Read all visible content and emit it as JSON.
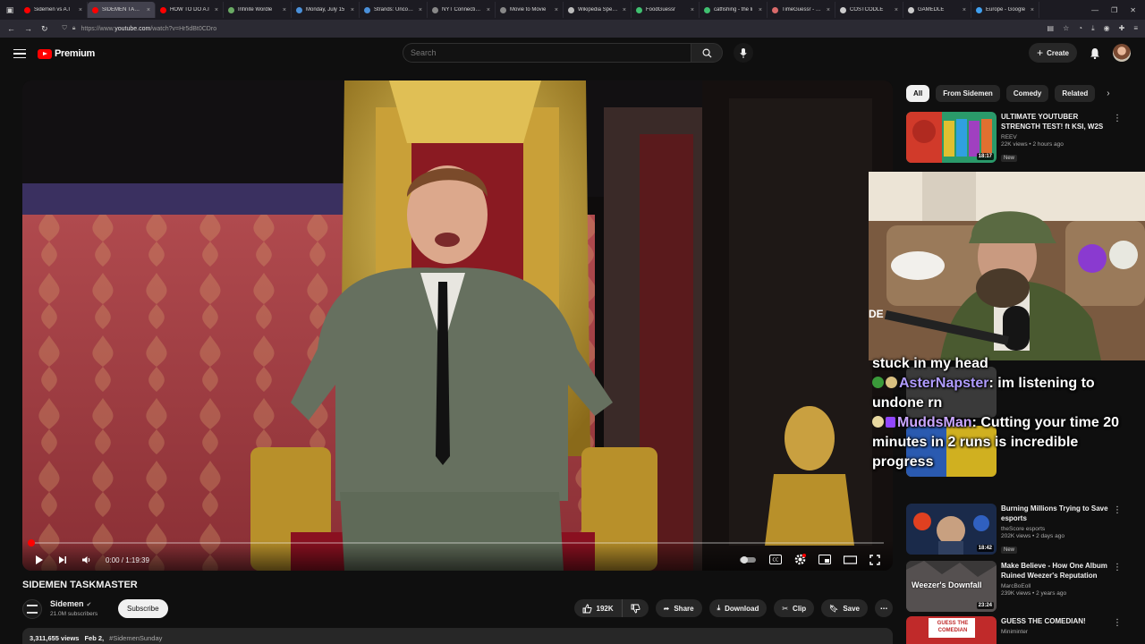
{
  "browser": {
    "tabs": [
      {
        "label": "Sidemen vs A.I",
        "color": "#ff0000",
        "active": false
      },
      {
        "label": "SIDEMEN TASKMASTER",
        "color": "#ff0000",
        "active": true
      },
      {
        "label": "HOW TO DO A.I",
        "color": "#ff0000",
        "active": false
      },
      {
        "label": "Infinite Wordle",
        "color": "#6aaa64",
        "active": false
      },
      {
        "label": "Monday, July 15",
        "color": "#4a90d9",
        "active": false
      },
      {
        "label": "Strands: Uncover",
        "color": "#4a90d9",
        "active": false
      },
      {
        "label": "NYT Connections",
        "color": "#888888",
        "active": false
      },
      {
        "label": "Movie to Movie",
        "color": "#888888",
        "active": false
      },
      {
        "label": "Wikipedia Speedrun!",
        "color": "#bbbbbb",
        "active": false
      },
      {
        "label": "FoodGuessr",
        "color": "#40c070",
        "active": false
      },
      {
        "label": "catfishing - the li",
        "color": "#40c070",
        "active": false
      },
      {
        "label": "TimeGuessr - Rec",
        "color": "#d96a6a",
        "active": false
      },
      {
        "label": "COSTCODLE",
        "color": "#cccccc",
        "active": false
      },
      {
        "label": "GAMEDLE",
        "color": "#cccccc",
        "active": false
      },
      {
        "label": "Europe - Google",
        "color": "#40a0f0",
        "active": false
      }
    ],
    "url_prefix": "https://www.",
    "url_domain": "youtube.com",
    "url_path": "/watch?v=Hr5dBt0CDro"
  },
  "header": {
    "brand": "Premium",
    "search_placeholder": "Search",
    "create_label": "Create"
  },
  "player": {
    "time": "0:00 / 1:19:39",
    "progress_fraction": 0.0
  },
  "video": {
    "title": "SIDEMEN TASKMASTER",
    "channel": "Sidemen",
    "subscribers": "21.0M subscribers",
    "subscribe_label": "Subscribe",
    "likes": "192K",
    "share_label": "Share",
    "download_label": "Download",
    "clip_label": "Clip",
    "save_label": "Save",
    "views": "3,311,655 views",
    "date": "Feb 2,",
    "hashtag": "#SidemenSunday"
  },
  "sidebar": {
    "chips": [
      "All",
      "From Sidemen",
      "Comedy",
      "Related"
    ],
    "recs": [
      {
        "title": "ULTIMATE YOUTUBER STRENGTH TEST! ft KSI, W2S",
        "channel": "REEV",
        "stats": "22K views • 2 hours ago",
        "badge": "New",
        "duration": "18:17"
      },
      {
        "title": "Burning Millions Trying to Save esports",
        "channel": "theScore esports",
        "stats": "202K views • 2 days ago",
        "badge": "New",
        "duration": "18:42"
      },
      {
        "title": "Make Believe - How One Album Ruined Weezer's Reputation",
        "channel": "MarcBoEoll",
        "stats": "239K views • 2 years ago",
        "badge": "",
        "duration": "23:24"
      },
      {
        "title": "GUESS THE COMEDIAN!",
        "channel": "Miniminter",
        "stats": "",
        "badge": "",
        "duration": ""
      }
    ],
    "thumb_texts": [
      "Weezer's Downfall",
      "GUESS THE COMEDIAN"
    ]
  },
  "stream": {
    "chat": [
      {
        "user": "",
        "text": "stuck in my head"
      },
      {
        "user": "AsterNapster",
        "text": ": im listening to undone rn"
      },
      {
        "user": "MuddsMan",
        "text": ": Cutting your time 20 minutes in 2 runs is incredible progress"
      }
    ],
    "mic_label": "DE"
  },
  "colors": {
    "accent": "#ff0000",
    "background": "#0f0f0f",
    "chat_user": "#b09cff"
  }
}
